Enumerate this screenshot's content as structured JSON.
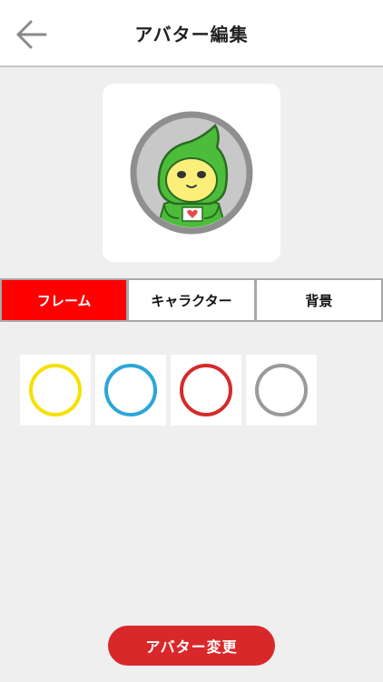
{
  "header": {
    "title": "アバター編集",
    "back_icon": "arrow-left-icon"
  },
  "preview": {
    "frame_color": "#8f8f8f",
    "character": "green-hooded-character"
  },
  "tabs": [
    {
      "label": "フレーム",
      "active": true
    },
    {
      "label": "キャラクター",
      "active": false
    },
    {
      "label": "背景",
      "active": false
    }
  ],
  "frames": [
    {
      "color": "#f5e100"
    },
    {
      "color": "#2ba6d9"
    },
    {
      "color": "#d62b2b"
    },
    {
      "color": "#9a9a9a"
    }
  ],
  "actions": {
    "change_label": "アバター変更"
  },
  "colors": {
    "accent": "#ff0000",
    "button": "#d9282a",
    "background": "#efefef"
  }
}
